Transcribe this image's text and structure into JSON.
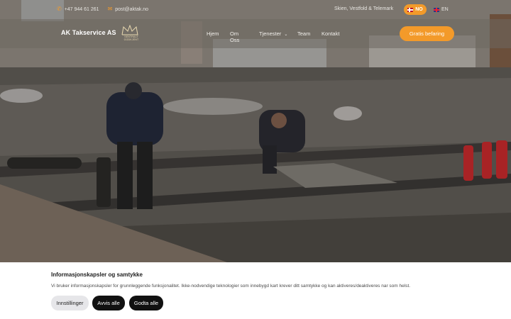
{
  "topbar": {
    "phone": "+47 944 61 261",
    "email": "post@aktak.no",
    "location": "Skien, Vestfold & Telemark",
    "lang_no": "NO",
    "lang_en": "EN"
  },
  "header": {
    "brand": "AK Takservice AS",
    "badge_line1": "SENTRALT",
    "badge_line2": "GODKJENT",
    "nav": [
      "Hjem",
      "Om Oss",
      "Tjenester",
      "Team",
      "Kontakt"
    ],
    "cta": "Gratis befaring"
  },
  "cookie": {
    "title": "Informasjonskapsler og samtykke",
    "text": "Vi bruker informasjonskapsler for grunnleggende funksjonalitet. Ikke-nodvendige teknologier som innebygd kart krever ditt samtykke og kan aktiveres/deaktiveres nar som helst.",
    "settings": "Innstillinger",
    "reject": "Avvis alle",
    "accept": "Godta alle"
  },
  "colors": {
    "accent": "#f39a2a",
    "dark_button": "#111111"
  }
}
